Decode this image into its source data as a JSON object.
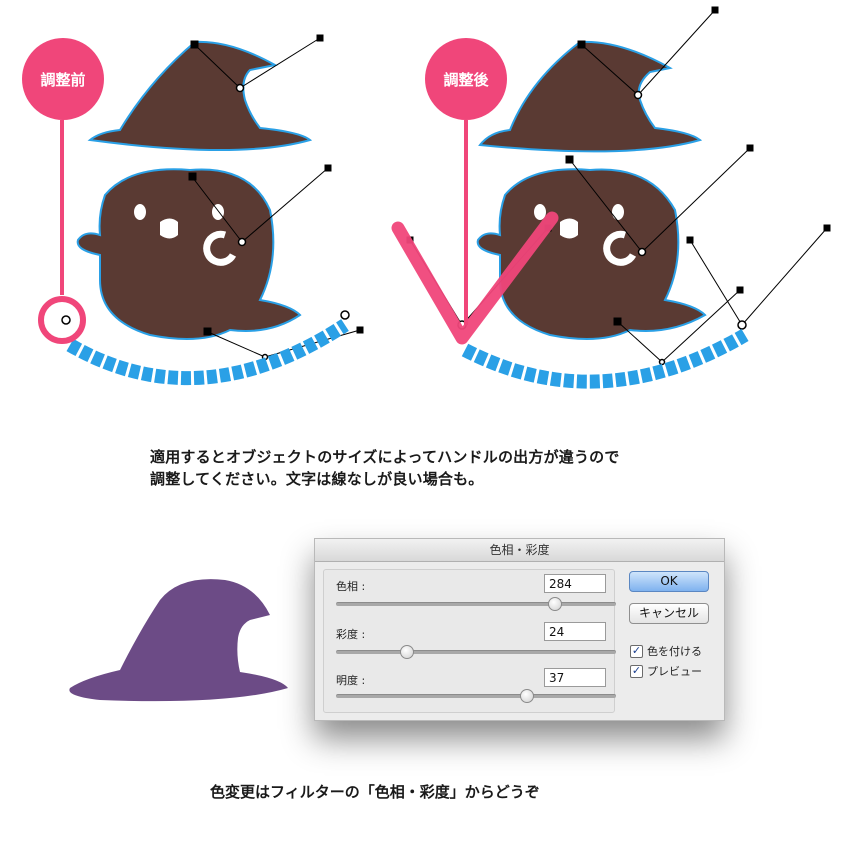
{
  "labels": {
    "before": "調整前",
    "after": "調整後",
    "caption_line1": "適用するとオブジェクトのサイズによってハンドルの出方が違うので",
    "caption_line2": "調整してください。文字は線なしが良い場合も。",
    "bottom_caption": "色変更はフィルターの「色相・彩度」からどうぞ"
  },
  "colors": {
    "accent_pink": "#f0467a",
    "ghost_brown": "#5a3a33",
    "path_blue": "#2aa0e6",
    "hat_purple": "#6c4b86"
  },
  "dialog": {
    "title": "色相・彩度",
    "hue": {
      "label": "色相 :",
      "value": "284",
      "slider": 0.78
    },
    "saturation": {
      "label": "彩度 :",
      "value": "24",
      "slider": 0.25
    },
    "lightness": {
      "label": "明度 :",
      "value": "37",
      "slider": 0.68
    },
    "ok_label": "OK",
    "cancel_label": "キャンセル",
    "colorize_label": "色を付ける",
    "preview_label": "プレビュー",
    "colorize_checked": true,
    "preview_checked": true
  }
}
